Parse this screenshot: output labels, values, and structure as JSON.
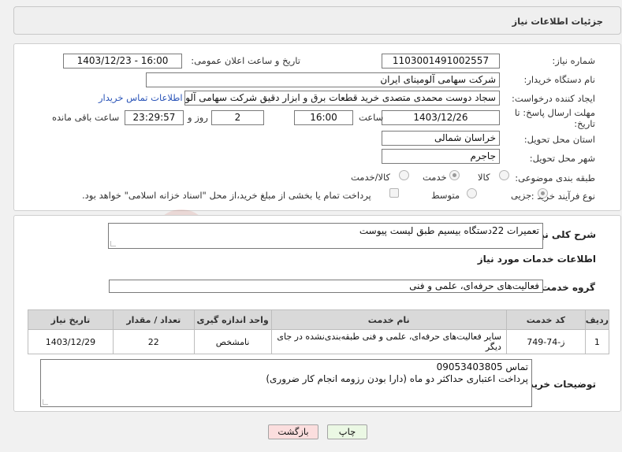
{
  "header": {
    "title": "جزئیات اطلاعات نیاز"
  },
  "need": {
    "number_label": "شماره نیاز:",
    "number": "1103001491002557",
    "announce_label": "تاریخ و ساعت اعلان عمومی:",
    "announce_value": "1403/12/23 - 16:00",
    "buyer_label": "نام دستگاه خریدار:",
    "buyer": "شرکت سهامی آلومینای ایران",
    "creator_label": "ایجاد کننده درخواست:",
    "creator": "سجاد دوست محمدی متصدی خرید قطعات برق و ابزار دقیق شرکت سهامی آلومینای ایران",
    "contact_link": "اطلاعات تماس خریدار",
    "deadline_label_1": "مهلت ارسال پاسخ: تا",
    "deadline_label_2": "تاریخ:",
    "deadline_date": "1403/12/26",
    "time_label": "ساعت",
    "deadline_time": "16:00",
    "days": "2",
    "days_label": "روز و",
    "remaining": "23:29:57",
    "remaining_label": "ساعت باقی مانده",
    "province_label": "استان محل تحویل:",
    "province": "خراسان شمالی",
    "city_label": "شهر محل تحویل:",
    "city": "جاجرم",
    "category_label": "طبقه بندی موضوعی:",
    "category_options": [
      "کالا",
      "خدمت",
      "کالا/خدمت"
    ],
    "category_selected": "خدمت",
    "process_label": "نوع فرآیند خرید :",
    "process_options": [
      "جزیی",
      "متوسط"
    ],
    "process_selected": "جزیی",
    "treasury_note": "پرداخت تمام یا بخشی از مبلغ خرید،از محل \"اسناد خزانه اسلامی\" خواهد بود."
  },
  "summary": {
    "label": "شرح کلی نیاز:",
    "value": "تعمیرات 22دستگاه بیسیم طبق لیست پیوست"
  },
  "services": {
    "section_title": "اطلاعات خدمات مورد نیاز",
    "group_label": "گروه خدمت:",
    "group_value": "فعالیت‌های حرفه‌ای، علمی و فنی",
    "table": {
      "headers": [
        "ردیف",
        "کد خدمت",
        "نام خدمت",
        "واحد اندازه گیری",
        "تعداد / مقدار",
        "تاریخ نیاز"
      ],
      "rows": [
        [
          "1",
          "ز-74-749",
          "سایر فعالیت‌های حرفه‌ای، علمی و فنی طبقه‌بندی‌نشده در جای دیگر",
          "نامشخص",
          "22",
          "1403/12/29"
        ]
      ]
    }
  },
  "buyer_notes": {
    "label": "توضیحات خریدار:",
    "line1": "تماس 09053403805",
    "line2": "پرداخت اعتباری حداکثر دو ماه (دارا بودن رزومه انجام کار ضروری)"
  },
  "buttons": {
    "print": "چاپ",
    "back": "بازگشت"
  },
  "watermark": {
    "text": "AriaTender.neT"
  },
  "colors": {
    "link": "#2a54b8",
    "back_button": "#fbdede",
    "print_button": "#ebf8e4",
    "table_header": "#d9d9d9"
  }
}
